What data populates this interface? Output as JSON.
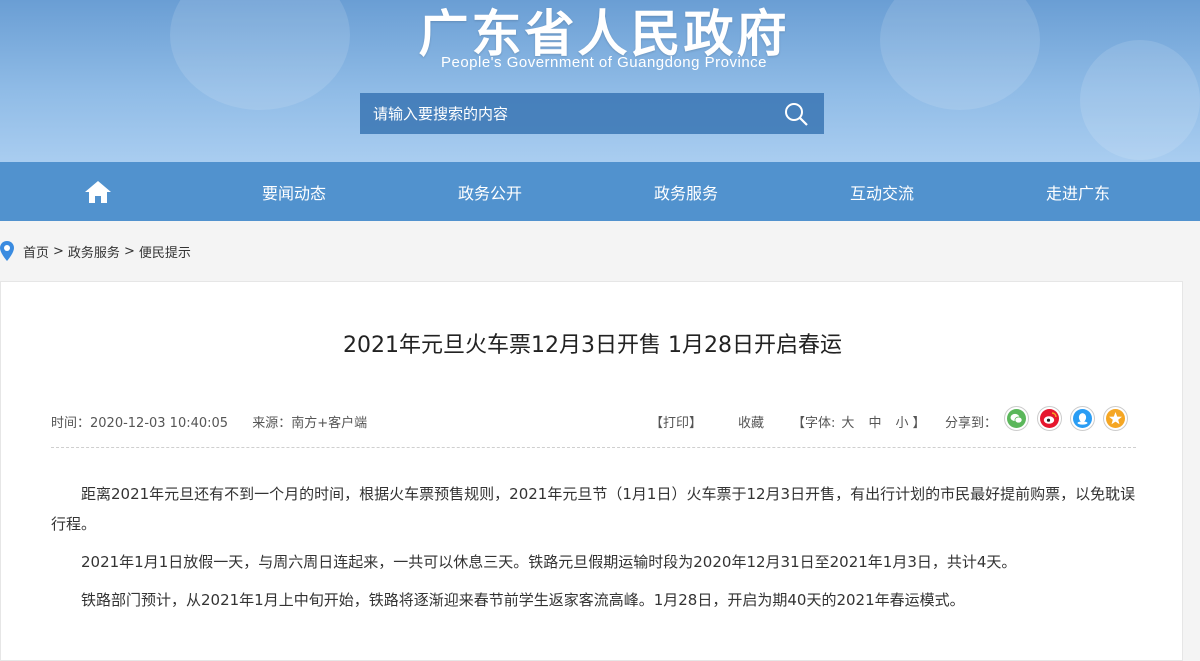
{
  "header": {
    "title": "广东省人民政府",
    "subtitle": "People's Government of Guangdong Province",
    "search_placeholder": "请输入要搜索的内容",
    "search_icon": "search-icon"
  },
  "nav": {
    "home_icon": "home-icon",
    "items": [
      "要闻动态",
      "政务公开",
      "政务服务",
      "互动交流",
      "走进广东"
    ]
  },
  "breadcrumb": {
    "icon": "location-pin-icon",
    "items": [
      "首页",
      "政务服务",
      "便民提示"
    ],
    "separator": ">"
  },
  "article": {
    "title": "2021年元旦火车票12月3日开售 1月28日开启春运",
    "time": "时间：2020-12-03 10:40:05",
    "source": "来源：南方+客户端",
    "print": "【打印】",
    "favorite": "收藏",
    "font_label": "【字体:",
    "font_large": "大",
    "font_medium": "中",
    "font_small": "小",
    "font_close": "】",
    "share_label": "分享到：",
    "share_icons": [
      "wechat-icon",
      "weibo-icon",
      "qq-icon",
      "qzone-icon"
    ],
    "share_colors": [
      "#5bb75b",
      "#e6162d",
      "#2a9df4",
      "#f5a623"
    ],
    "paragraphs": [
      "距离2021年元旦还有不到一个月的时间，根据火车票预售规则，2021年元旦节（1月1日）火车票于12月3日开售，有出行计划的市民最好提前购票，以免耽误行程。",
      "2021年1月1日放假一天，与周六周日连起来，一共可以休息三天。铁路元旦假期运输时段为2020年12月31日至2021年1月3日，共计4天。",
      "铁路部门预计，从2021年1月上中旬开始，铁路将逐渐迎来春节前学生返家客流高峰。1月28日，开启为期40天的2021年春运模式。"
    ]
  }
}
